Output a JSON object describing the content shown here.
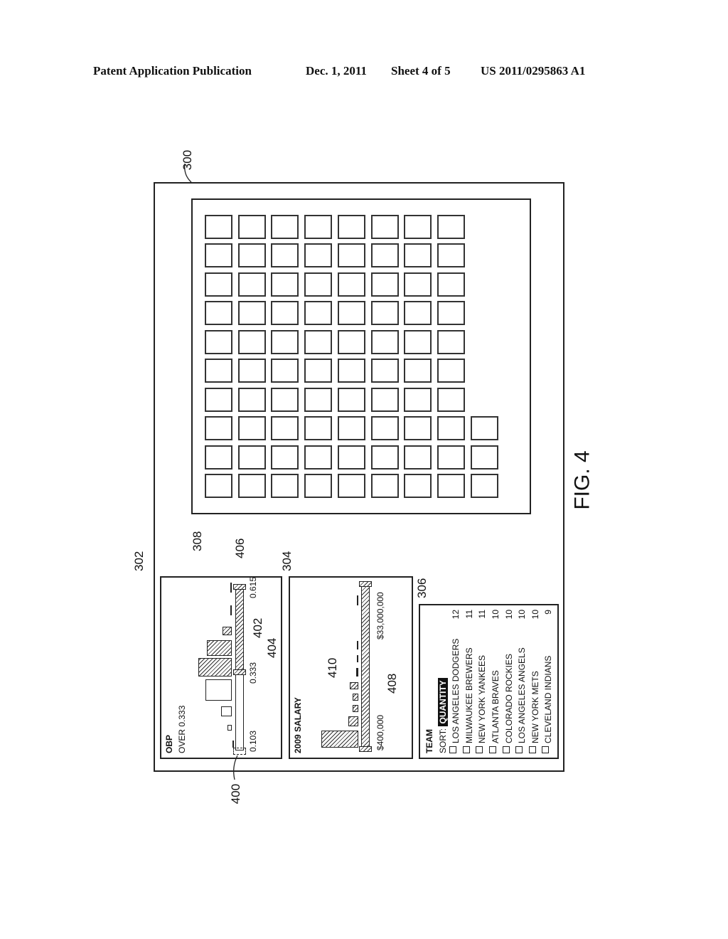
{
  "header": {
    "publication": "Patent Application Publication",
    "date": "Dec. 1, 2011",
    "sheet": "Sheet 4 of 5",
    "number": "US 2011/0295863 A1"
  },
  "figure_label": "FIG. 4",
  "refs": {
    "screen": "300",
    "obp_panel": "302",
    "salary_panel": "304",
    "team_panel": "306",
    "grid_panel": "308",
    "slider_handle": "400",
    "range_bar": "402",
    "range_marker": "404",
    "grid_item": "406",
    "salary_range_bar": "408",
    "salary_histogram": "410"
  },
  "obp": {
    "title": "OBP",
    "subtitle": "OVER 0.333",
    "min_label": "0.103",
    "mid_label": "0.333",
    "max_label": "0.615",
    "selected_range": [
      0.333,
      0.615
    ]
  },
  "salary": {
    "title": "2009 SALARY",
    "min_label": "$400,000",
    "max_label": "$33,000,000"
  },
  "team": {
    "title": "TEAM",
    "sort_label": "SORT:",
    "sort_value": "QUANTITY",
    "items": [
      {
        "name": "LOS ANGELES DODGERS",
        "count": "12"
      },
      {
        "name": "MILWAUKEE BREWERS",
        "count": "11"
      },
      {
        "name": "NEW YORK YANKEES",
        "count": "11"
      },
      {
        "name": "ATLANTA BRAVES",
        "count": "10"
      },
      {
        "name": "COLORADO ROCKIES",
        "count": "10"
      },
      {
        "name": "LOS ANGELES ANGELS",
        "count": "10"
      },
      {
        "name": "NEW YORK METS",
        "count": "10"
      },
      {
        "name": "CLEVELAND INDIANS",
        "count": "9"
      }
    ]
  },
  "grid": {
    "rows": 10,
    "row_counts": [
      8,
      8,
      8,
      8,
      8,
      8,
      8,
      9,
      9,
      9
    ]
  }
}
